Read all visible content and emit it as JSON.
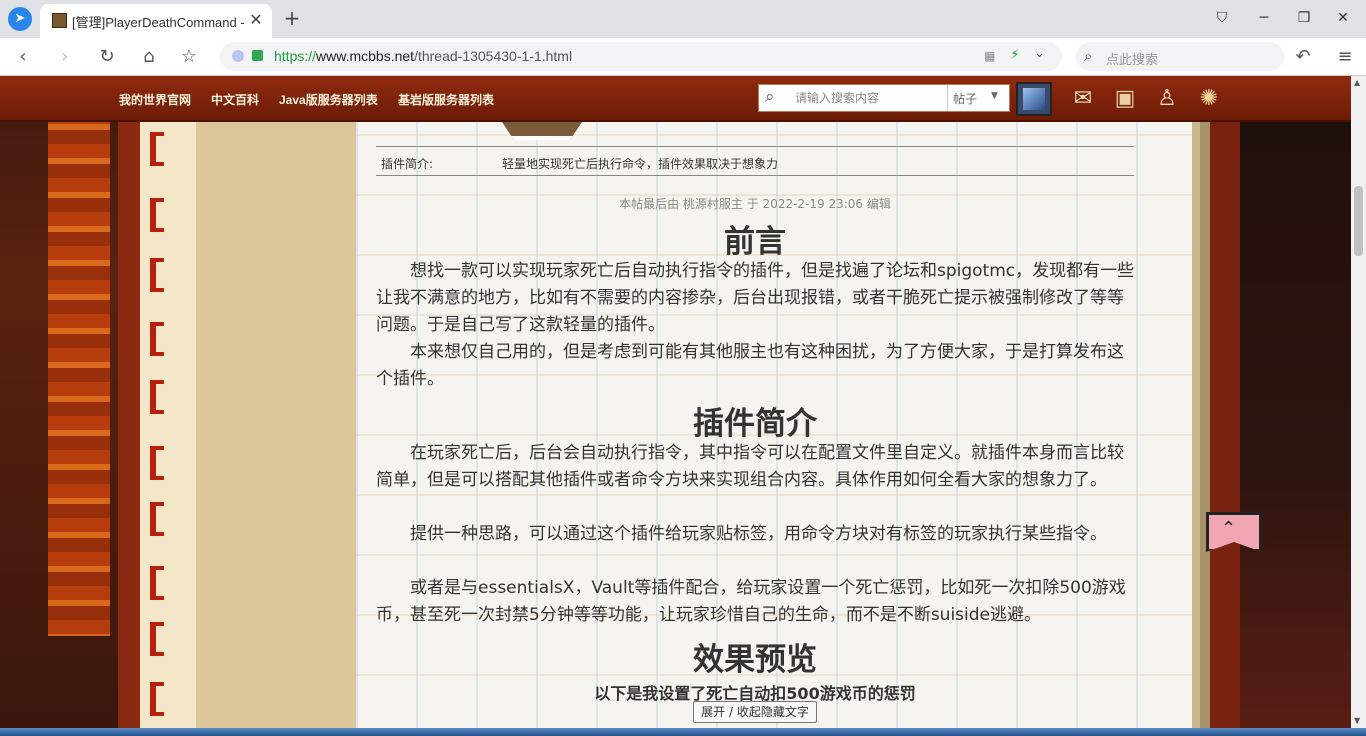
{
  "browser": {
    "tab_title": "[管理]PlayerDeathCommand - ",
    "tab_close": "✕",
    "new_tab": "+",
    "url_protocol": "https://",
    "url_host": "www.mcbbs.net",
    "url_path": "/thread-1305430-1-1.html",
    "search_placeholder": "点此搜索"
  },
  "site_nav": {
    "items": [
      "我的世界官网",
      "中文百科",
      "Java版服务器列表",
      "基岩版服务器列表"
    ]
  },
  "site_search": {
    "placeholder": "请输入搜索内容",
    "type": "帖子"
  },
  "post": {
    "info_label": "插件简介:",
    "info_value": "轻量地实现死亡后执行命令，插件效果取决于想象力",
    "edit_note": "本帖最后由 桃源村服主 于 2022-2-19 23:06 编辑",
    "section1_title": "前言",
    "section1_p1": "想找一款可以实现玩家死亡后自动执行指令的插件，但是找遍了论坛和spigotmc，发现都有一些让我不满意的地方，比如有不需要的内容掺杂，后台出现报错，或者干脆死亡提示被强制修改了等等问题。于是自己写了这款轻量的插件。",
    "section1_p2": "本来想仅自己用的，但是考虑到可能有其他服主也有这种困扰，为了方便大家，于是打算发布这个插件。",
    "section2_title": "插件简介",
    "section2_p1": "在玩家死亡后，后台会自动执行指令，其中指令可以在配置文件里自定义。就插件本身而言比较简单，但是可以搭配其他插件或者命令方块来实现组合内容。具体作用如何全看大家的想象力了。",
    "section2_p2": "提供一种思路，可以通过这个插件给玩家贴标签，用命令方块对有标签的玩家执行某些指令。",
    "section2_p3": "或者是与essentialsX，Vault等插件配合，给玩家设置一个死亡惩罚，比如死一次扣除500游戏币，甚至死一次封禁5分钟等等功能，让玩家珍惜自己的生命，而不是不断suiside逃避。",
    "section3_title": "效果预览",
    "section3_sub": "以下是我设置了死亡自动扣500游戏币的惩罚",
    "toggle_label": "展开 / 收起隐藏文字"
  },
  "colors": {
    "header_bg": "#8f2a0e",
    "text": "#333333",
    "url_secure": "#1f9d3a"
  }
}
